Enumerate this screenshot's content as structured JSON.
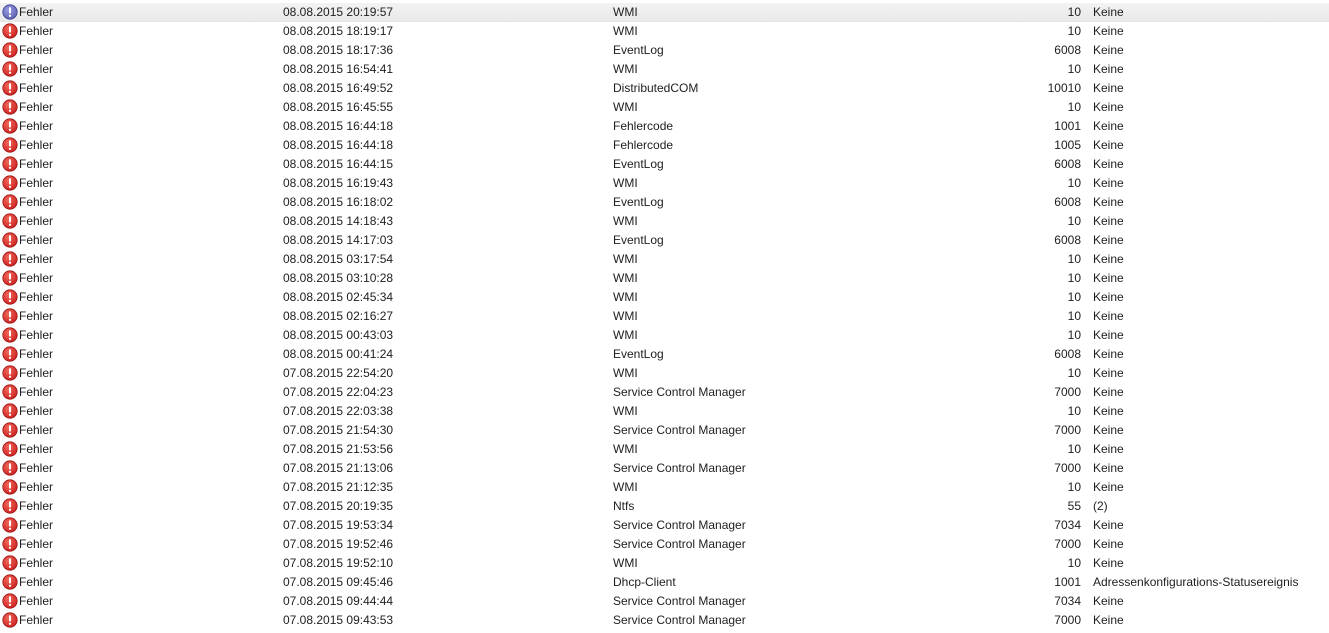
{
  "icon_color": "#cc1f1f",
  "selected_icon_color": "#5b5fb0",
  "rows": [
    {
      "level": "Fehler",
      "date": "08.08.2015 20:19:57",
      "source": "WMI",
      "id": "10",
      "task": "Keine",
      "icon": "error-icon",
      "selected": true
    },
    {
      "level": "Fehler",
      "date": "08.08.2015 18:19:17",
      "source": "WMI",
      "id": "10",
      "task": "Keine",
      "icon": "error-icon"
    },
    {
      "level": "Fehler",
      "date": "08.08.2015 18:17:36",
      "source": "EventLog",
      "id": "6008",
      "task": "Keine",
      "icon": "error-icon"
    },
    {
      "level": "Fehler",
      "date": "08.08.2015 16:54:41",
      "source": "WMI",
      "id": "10",
      "task": "Keine",
      "icon": "error-icon"
    },
    {
      "level": "Fehler",
      "date": "08.08.2015 16:49:52",
      "source": "DistributedCOM",
      "id": "10010",
      "task": "Keine",
      "icon": "error-icon"
    },
    {
      "level": "Fehler",
      "date": "08.08.2015 16:45:55",
      "source": "WMI",
      "id": "10",
      "task": "Keine",
      "icon": "error-icon"
    },
    {
      "level": "Fehler",
      "date": "08.08.2015 16:44:18",
      "source": "Fehlercode",
      "id": "1001",
      "task": "Keine",
      "icon": "error-icon"
    },
    {
      "level": "Fehler",
      "date": "08.08.2015 16:44:18",
      "source": "Fehlercode",
      "id": "1005",
      "task": "Keine",
      "icon": "error-icon"
    },
    {
      "level": "Fehler",
      "date": "08.08.2015 16:44:15",
      "source": "EventLog",
      "id": "6008",
      "task": "Keine",
      "icon": "error-icon"
    },
    {
      "level": "Fehler",
      "date": "08.08.2015 16:19:43",
      "source": "WMI",
      "id": "10",
      "task": "Keine",
      "icon": "error-icon"
    },
    {
      "level": "Fehler",
      "date": "08.08.2015 16:18:02",
      "source": "EventLog",
      "id": "6008",
      "task": "Keine",
      "icon": "error-icon"
    },
    {
      "level": "Fehler",
      "date": "08.08.2015 14:18:43",
      "source": "WMI",
      "id": "10",
      "task": "Keine",
      "icon": "error-icon"
    },
    {
      "level": "Fehler",
      "date": "08.08.2015 14:17:03",
      "source": "EventLog",
      "id": "6008",
      "task": "Keine",
      "icon": "error-icon"
    },
    {
      "level": "Fehler",
      "date": "08.08.2015 03:17:54",
      "source": "WMI",
      "id": "10",
      "task": "Keine",
      "icon": "error-icon"
    },
    {
      "level": "Fehler",
      "date": "08.08.2015 03:10:28",
      "source": "WMI",
      "id": "10",
      "task": "Keine",
      "icon": "error-icon"
    },
    {
      "level": "Fehler",
      "date": "08.08.2015 02:45:34",
      "source": "WMI",
      "id": "10",
      "task": "Keine",
      "icon": "error-icon"
    },
    {
      "level": "Fehler",
      "date": "08.08.2015 02:16:27",
      "source": "WMI",
      "id": "10",
      "task": "Keine",
      "icon": "error-icon"
    },
    {
      "level": "Fehler",
      "date": "08.08.2015 00:43:03",
      "source": "WMI",
      "id": "10",
      "task": "Keine",
      "icon": "error-icon"
    },
    {
      "level": "Fehler",
      "date": "08.08.2015 00:41:24",
      "source": "EventLog",
      "id": "6008",
      "task": "Keine",
      "icon": "error-icon"
    },
    {
      "level": "Fehler",
      "date": "07.08.2015 22:54:20",
      "source": "WMI",
      "id": "10",
      "task": "Keine",
      "icon": "error-icon"
    },
    {
      "level": "Fehler",
      "date": "07.08.2015 22:04:23",
      "source": "Service Control Manager",
      "id": "7000",
      "task": "Keine",
      "icon": "error-icon"
    },
    {
      "level": "Fehler",
      "date": "07.08.2015 22:03:38",
      "source": "WMI",
      "id": "10",
      "task": "Keine",
      "icon": "error-icon"
    },
    {
      "level": "Fehler",
      "date": "07.08.2015 21:54:30",
      "source": "Service Control Manager",
      "id": "7000",
      "task": "Keine",
      "icon": "error-icon"
    },
    {
      "level": "Fehler",
      "date": "07.08.2015 21:53:56",
      "source": "WMI",
      "id": "10",
      "task": "Keine",
      "icon": "error-icon"
    },
    {
      "level": "Fehler",
      "date": "07.08.2015 21:13:06",
      "source": "Service Control Manager",
      "id": "7000",
      "task": "Keine",
      "icon": "error-icon"
    },
    {
      "level": "Fehler",
      "date": "07.08.2015 21:12:35",
      "source": "WMI",
      "id": "10",
      "task": "Keine",
      "icon": "error-icon"
    },
    {
      "level": "Fehler",
      "date": "07.08.2015 20:19:35",
      "source": "Ntfs",
      "id": "55",
      "task": "(2)",
      "icon": "error-icon"
    },
    {
      "level": "Fehler",
      "date": "07.08.2015 19:53:34",
      "source": "Service Control Manager",
      "id": "7034",
      "task": "Keine",
      "icon": "error-icon"
    },
    {
      "level": "Fehler",
      "date": "07.08.2015 19:52:46",
      "source": "Service Control Manager",
      "id": "7000",
      "task": "Keine",
      "icon": "error-icon"
    },
    {
      "level": "Fehler",
      "date": "07.08.2015 19:52:10",
      "source": "WMI",
      "id": "10",
      "task": "Keine",
      "icon": "error-icon"
    },
    {
      "level": "Fehler",
      "date": "07.08.2015 09:45:46",
      "source": "Dhcp-Client",
      "id": "1001",
      "task": "Adressenkonfigurations-Statusereignis",
      "icon": "error-icon"
    },
    {
      "level": "Fehler",
      "date": "07.08.2015 09:44:44",
      "source": "Service Control Manager",
      "id": "7034",
      "task": "Keine",
      "icon": "error-icon"
    },
    {
      "level": "Fehler",
      "date": "07.08.2015 09:43:53",
      "source": "Service Control Manager",
      "id": "7000",
      "task": "Keine",
      "icon": "error-icon"
    }
  ]
}
